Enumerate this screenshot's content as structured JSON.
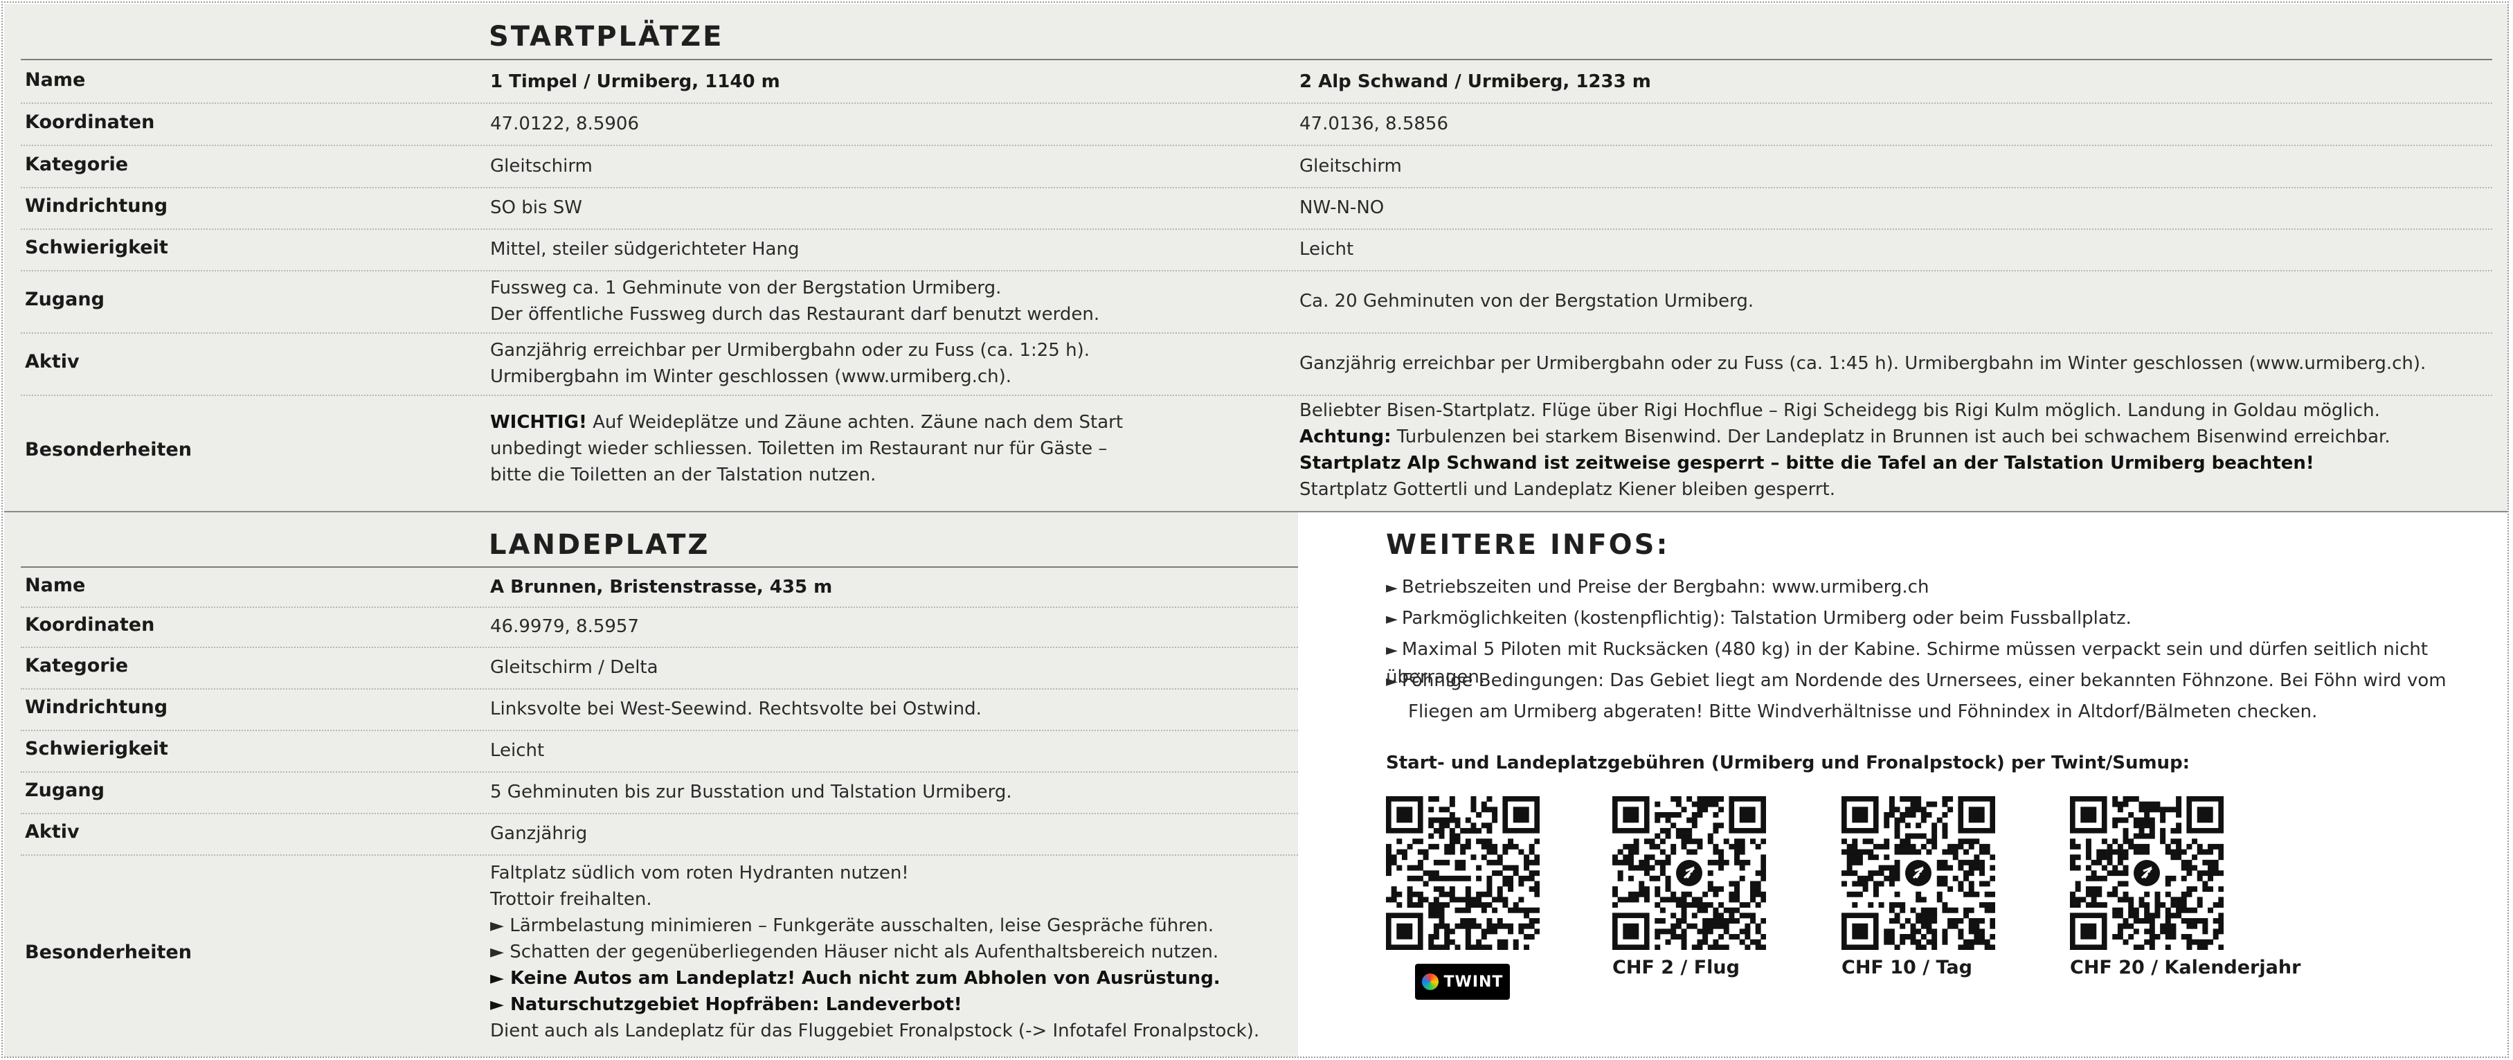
{
  "startplaetze": {
    "title": "STARTPLÄTZE",
    "rows": [
      {
        "label": "Name",
        "col1": [
          "1 Timpel / Urmiberg, 1140 m"
        ],
        "col2": [
          "2 Alp Schwand / Urmiberg, 1233 m"
        ]
      },
      {
        "label": "Koordinaten",
        "col1": [
          "47.0122, 8.5906"
        ],
        "col2": [
          "47.0136, 8.5856"
        ]
      },
      {
        "label": "Kategorie",
        "col1": [
          "Gleitschirm"
        ],
        "col2": [
          "Gleitschirm"
        ]
      },
      {
        "label": "Windrichtung",
        "col1": [
          "SO bis SW"
        ],
        "col2": [
          "NW-N-NO"
        ]
      },
      {
        "label": "Schwierigkeit",
        "col1": [
          "Mittel, steiler südgerichteter Hang"
        ],
        "col2": [
          "Leicht"
        ]
      },
      {
        "label": "Zugang",
        "col1": [
          "Fussweg ca. 1 Gehminute von der Bergstation Urmiberg.",
          "Der öffentliche Fussweg durch das Restaurant darf benutzt werden."
        ],
        "col2": [
          "Ca. 20 Gehminuten von der Bergstation Urmiberg."
        ]
      },
      {
        "label": "Aktiv",
        "col1": [
          "Ganzjährig erreichbar per Urmibergbahn oder zu Fuss (ca. 1:25 h).",
          "Urmibergbahn im Winter geschlossen (www.urmiberg.ch)."
        ],
        "col2": [
          "Ganzjährig erreichbar per Urmibergbahn oder zu Fuss (ca. 1:45 h). Urmibergbahn im Winter geschlossen (www.urmiberg.ch)."
        ]
      },
      {
        "label": "Besonderheiten",
        "col1_bold_prefix": "WICHTIG!",
        "col1": [
          " Auf Weideplätze und Zäune achten. Zäune nach dem Start",
          "unbedingt wieder schliessen. Toiletten im Restaurant nur für Gäste –",
          "bitte die Toiletten an der Talstation nutzen."
        ],
        "col2_line1": "Beliebter Bisen-Startplatz. Flüge über Rigi Hochflue – Rigi Scheidegg bis Rigi Kulm möglich. Landung in Goldau möglich.",
        "col2_line2_bold": "Achtung:",
        "col2_line2": " Turbulenzen bei starkem Bisenwind. Der Landeplatz in Brunnen ist auch bei schwachem Bisenwind erreichbar.",
        "col2_line3_bold": "Startplatz Alp Schwand ist zeitweise gesperrt – bitte die Tafel an der Talstation Urmiberg beachten!",
        "col2_line4": "Startplatz Gottertli und Landeplatz Kiener bleiben gesperrt."
      }
    ]
  },
  "landeplatz": {
    "title": "LANDEPLATZ",
    "rows": [
      {
        "label": "Name",
        "value": "A Brunnen, Bristenstrasse, 435 m"
      },
      {
        "label": "Koordinaten",
        "value": "46.9979, 8.5957"
      },
      {
        "label": "Kategorie",
        "value": "Gleitschirm / Delta"
      },
      {
        "label": "Windrichtung",
        "value": "Linksvolte bei West-Seewind. Rechtsvolte bei Ostwind."
      },
      {
        "label": "Schwierigkeit",
        "value": "Leicht"
      },
      {
        "label": "Zugang",
        "value": "5 Gehminuten bis zur Busstation und Talstation Urmiberg."
      },
      {
        "label": "Aktiv",
        "value": "Ganzjährig"
      },
      {
        "label": "Besonderheiten",
        "lines": [
          {
            "text": "Faltplatz südlich vom roten Hydranten nutzen!",
            "bold": false
          },
          {
            "text": "Trottoir freihalten.",
            "bold": false
          },
          {
            "text": "► Lärmbelastung minimieren – Funkgeräte ausschalten, leise Gespräche führen.",
            "bold": false
          },
          {
            "text": "► Schatten der gegenüberliegenden Häuser nicht als Aufenthaltsbereich nutzen.",
            "bold": false
          },
          {
            "text": "► Keine Autos am Landeplatz! Auch nicht zum Abholen von Ausrüstung.",
            "bold": true
          },
          {
            "text": "► Naturschutzgebiet Hopfräben: Landeverbot!",
            "bold": true
          },
          {
            "text": "Dient auch als Landeplatz für das Fluggebiet Fronalpstock (-> Infotafel Fronalpstock).",
            "bold": false
          }
        ]
      }
    ]
  },
  "weitere_infos": {
    "title": "WEITERE INFOS:",
    "items": [
      "Betriebszeiten und Preise der Bergbahn: www.urmiberg.ch",
      "Parkmöglichkeiten (kostenpflichtig): Talstation Urmiberg oder beim Fussballplatz.",
      "Maximal 5 Piloten mit Rucksäcken (480 kg) in der Kabine. Schirme müssen verpackt sein und dürfen seitlich nicht überragen.",
      "Föhnige Bedingungen: Das Gebiet liegt am Nordende des Urnersees, einer bekannten Föhnzone. Bei Föhn wird vom"
    ],
    "item4_continued": "Fliegen am Urmiberg abgeraten! Bitte Windverhältnisse und Föhnindex in Altdorf/Bälmeten checken.",
    "fees_title": "Start- und Landeplatzgebühren (Urmiberg und Fronalpstock) per Twint/Sumup:",
    "twint_label": "TWINT",
    "qr_captions": [
      "CHF 2 / Flug",
      "CHF 10 / Tag",
      "CHF 20 / Kalenderjahr"
    ]
  },
  "colors": {
    "panel_grey": "#ededea",
    "text": "#1a1a1a",
    "twint_badge": "#000000"
  }
}
